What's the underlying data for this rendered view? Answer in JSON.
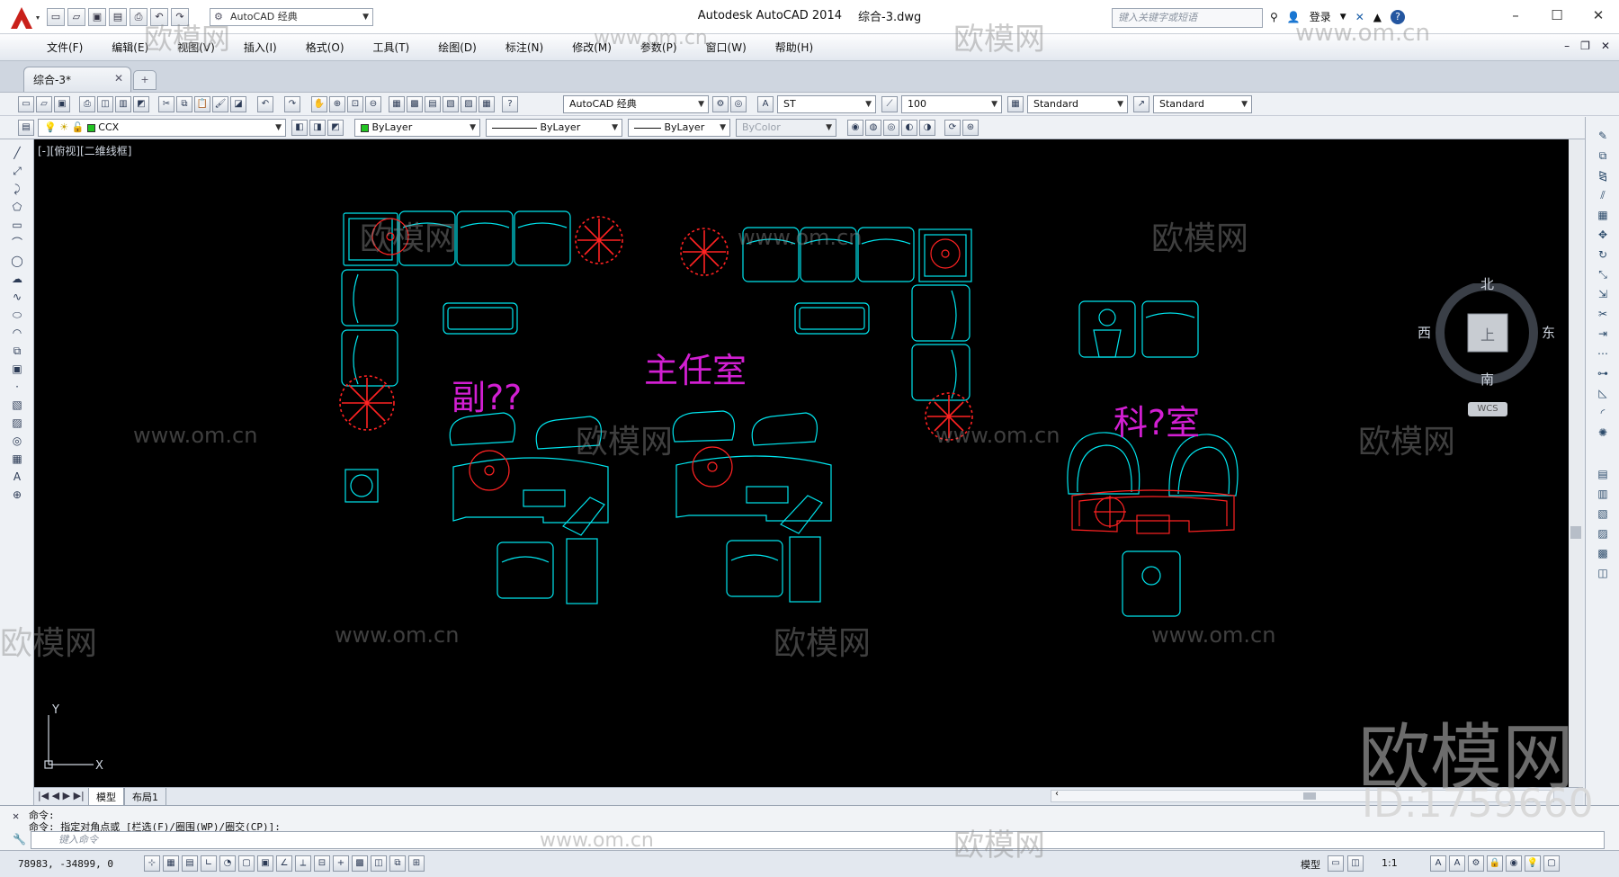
{
  "app": {
    "title": "Autodesk AutoCAD 2014",
    "file": "综合-3.dwg"
  },
  "quick_access": {
    "workspace": "AutoCAD 经典"
  },
  "search": {
    "placeholder": "键入关键字或短语"
  },
  "account": {
    "login": "登录"
  },
  "menus": [
    "文件(F)",
    "编辑(E)",
    "视图(V)",
    "插入(I)",
    "格式(O)",
    "工具(T)",
    "绘图(D)",
    "标注(N)",
    "修改(M)",
    "参数(P)",
    "窗口(W)",
    "帮助(H)"
  ],
  "doc_tab": {
    "name": "综合-3*"
  },
  "toolbar": {
    "workspace": "AutoCAD 经典",
    "text_style": "ST",
    "dim_scale": "100",
    "dim_style": "Standard",
    "table_style": "Standard",
    "layer": "CCX",
    "color": "ByLayer",
    "linetype": "ByLayer",
    "lineweight": "ByLayer",
    "plotstyle": "ByColor"
  },
  "viewport": {
    "label": "[-][俯视][二维线框]"
  },
  "viewcube": {
    "north": "北",
    "south": "南",
    "east": "东",
    "west": "西",
    "top": "上",
    "wcs": "WCS"
  },
  "ucs": {
    "x": "X",
    "y": "Y"
  },
  "drawing_labels": {
    "deputy": "副??",
    "director": "主任室",
    "section": "科?室"
  },
  "layout_tabs": [
    "模型",
    "布局1"
  ],
  "command": {
    "line1": "命令:",
    "line2": "命令: 指定对角点或 [栏选(F)/圈围(WP)/圈交(CP)]:",
    "placeholder": "键入命令"
  },
  "status": {
    "coords": "78983, -34899, 0",
    "model": "模型",
    "scale": "1:1"
  },
  "watermark": {
    "brand": "欧模网",
    "url": "www.om.cn",
    "id": "ID:1759660"
  },
  "colors": {
    "furniture": "#00e5ee",
    "plant": "#ff1a1a",
    "label": "#d21fd2",
    "canvas": "#000000"
  }
}
